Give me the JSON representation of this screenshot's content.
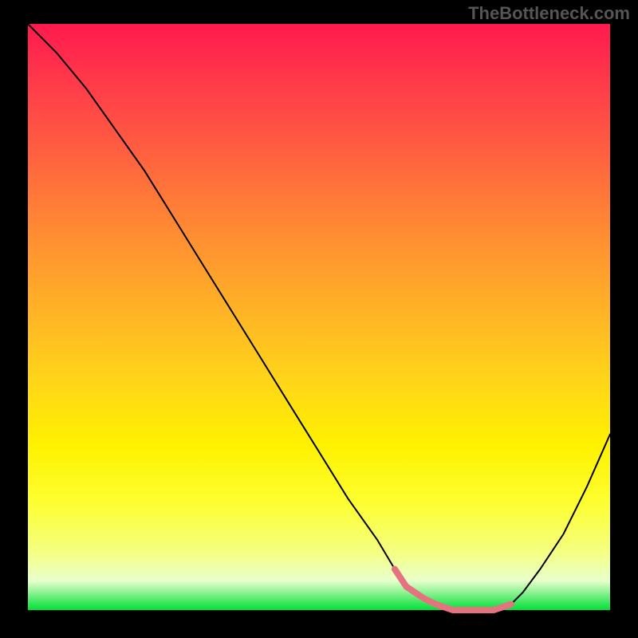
{
  "watermark": "TheBottleneck.com",
  "chart_data": {
    "type": "line",
    "title": "",
    "xlabel": "",
    "ylabel": "",
    "xlim": [
      0,
      100
    ],
    "ylim": [
      0,
      100
    ],
    "background_gradient": {
      "top_color": "#ff1a4d",
      "bottom_color": "#00e038",
      "direction": "top-to-bottom"
    },
    "series": [
      {
        "name": "bottleneck-curve",
        "color": "#000000",
        "x": [
          0,
          5,
          10,
          15,
          20,
          25,
          30,
          35,
          40,
          45,
          50,
          55,
          60,
          63,
          65,
          68,
          70,
          73,
          76,
          80,
          83,
          85,
          88,
          92,
          96,
          100
        ],
        "y": [
          100,
          95,
          89,
          82,
          75,
          67,
          59,
          51,
          43,
          35,
          27,
          19,
          12,
          7,
          4,
          2,
          1,
          0,
          0,
          0,
          1,
          3,
          7,
          13,
          21,
          30
        ]
      },
      {
        "name": "optimal-range-highlight",
        "color": "#e5737f",
        "x": [
          63,
          65,
          68,
          70,
          73,
          76,
          80,
          83
        ],
        "y": [
          7,
          4,
          2,
          1,
          0,
          0,
          0,
          1
        ]
      }
    ],
    "annotations": []
  }
}
